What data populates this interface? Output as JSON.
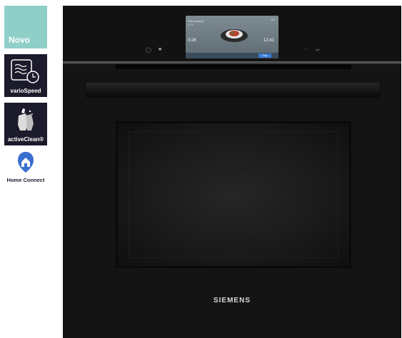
{
  "badges": {
    "novo": "Novo",
    "vario_speed": "varioSpeed",
    "active_clean": "activeClean®",
    "home_connect": "Home Connect"
  },
  "oven": {
    "brand": "SIEMENS",
    "display": {
      "title": "Fast cooked",
      "subtitle": "10 %",
      "status": "⚲ ≡",
      "time_left": "0:26",
      "time_right": "12:41",
      "button": "Stop"
    }
  },
  "colors": {
    "novo_bg": "#8fcfc8",
    "badge_dark": "#1b1b2b",
    "oven_body": "#141414",
    "accent_blue": "#3a7bd5"
  }
}
